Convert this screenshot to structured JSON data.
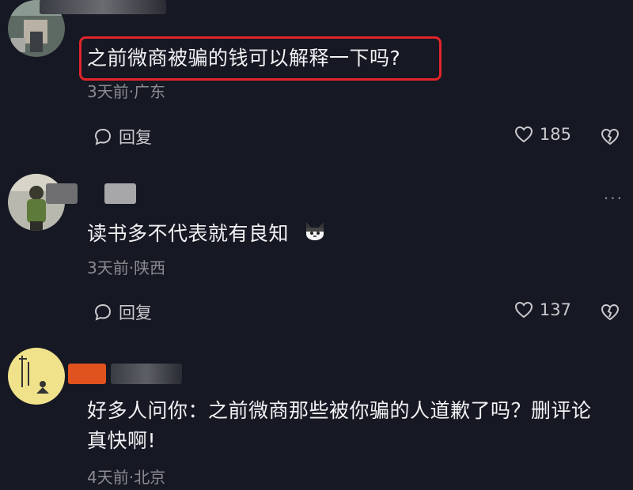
{
  "colors": {
    "background": "#161823",
    "text_primary": "#f2f2f4",
    "text_secondary": "#8a8b91",
    "highlight_border": "#e0252b"
  },
  "comments": [
    {
      "text": "之前微商被骗的钱可以解释一下吗?",
      "meta": "3天前·广东",
      "reply_label": "回复",
      "likes": "185",
      "highlighted": true
    },
    {
      "text": "读书多不代表就有良知",
      "meta": "3天前·陕西",
      "reply_label": "回复",
      "likes": "137",
      "more": "···"
    },
    {
      "text_line1": "好多人问你：之前微商那些被你骗的人道歉了吗？删评论",
      "text_line2": "真快啊!",
      "meta": "4天前·北京"
    }
  ],
  "icons": {
    "reply": "reply-bubble-icon",
    "like": "heart-outline-icon",
    "dislike": "broken-heart-icon",
    "emoji": "cat-face-emoji-icon"
  }
}
